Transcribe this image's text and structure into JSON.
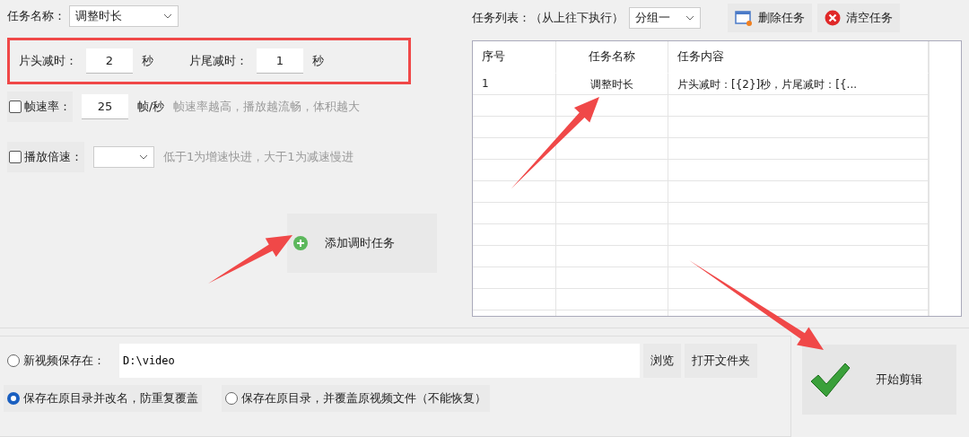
{
  "task_name": {
    "label": "任务名称：",
    "value": "调整时长"
  },
  "trim": {
    "highlighted": true,
    "fields": [
      {
        "label": "片头减时：",
        "value": "2",
        "unit": "秒"
      },
      {
        "label": "片尾减时：",
        "value": "1",
        "unit": "秒"
      }
    ]
  },
  "options": [
    {
      "kind": "input",
      "label": "帧速率：",
      "checked": false,
      "value": "25",
      "unit": "帧/秒",
      "hint": "帧速率越高，播放越流畅，体积越大"
    },
    {
      "kind": "select",
      "label": "播放倍速：",
      "checked": false,
      "hint": "低于1为增速快进，大于1为减速慢进"
    }
  ],
  "add_button": {
    "label": "添加调时任务",
    "arrow": true
  },
  "task_list": {
    "label": "任务列表：（从上往下执行）",
    "group": "分组一",
    "arrow": true,
    "buttons": [
      {
        "kind": "delete",
        "label": "删除任务"
      },
      {
        "kind": "clear",
        "label": "清空任务"
      }
    ],
    "columns": [
      "序号",
      "任务名称",
      "任务内容"
    ],
    "rows": [
      [
        "1",
        "调整时长",
        "片头减时：[{2}]秒，片尾减时：[{..."
      ]
    ]
  },
  "save": {
    "options": [
      {
        "kind": "folder",
        "label": "新视频保存在：",
        "selected": false,
        "path": "D:\\video",
        "buttons": [
          "浏览",
          "打开文件夹"
        ]
      },
      {
        "kind": "plain",
        "label": "保存在原目录并改名，防重复覆盖",
        "selected": true
      },
      {
        "kind": "plain",
        "label": "保存在原目录，并覆盖原视频文件（不能恢复）",
        "selected": false
      }
    ]
  },
  "start_button": {
    "label": "开始剪辑",
    "arrow": true
  }
}
